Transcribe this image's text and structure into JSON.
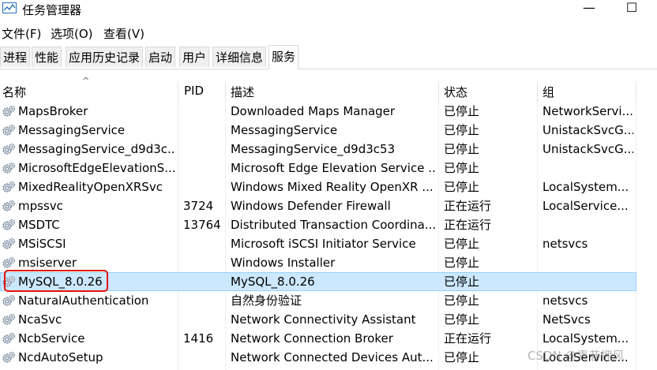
{
  "window": {
    "title": "任务管理器",
    "minimize": "—",
    "maximize": "☐"
  },
  "menu": [
    "文件(F)",
    "选项(O)",
    "查看(V)"
  ],
  "tabs": [
    "进程",
    "性能",
    "应用历史记录",
    "启动",
    "用户",
    "详细信息",
    "服务"
  ],
  "active_tab": "服务",
  "columns": {
    "name": "名称",
    "pid": "PID",
    "desc": "描述",
    "status": "状态",
    "group": "组"
  },
  "sort_indicator": "^",
  "services": [
    {
      "name": "MapsBroker",
      "pid": "",
      "desc": "Downloaded Maps Manager",
      "status": "已停止",
      "group": "NetworkServi..."
    },
    {
      "name": "MessagingService",
      "pid": "",
      "desc": "MessagingService",
      "status": "已停止",
      "group": "UnistackSvcG..."
    },
    {
      "name": "MessagingService_d9d3c...",
      "pid": "",
      "desc": "MessagingService_d9d3c53",
      "status": "已停止",
      "group": "UnistackSvcG..."
    },
    {
      "name": "MicrosoftEdgeElevationS...",
      "pid": "",
      "desc": "Microsoft Edge Elevation Service ...",
      "status": "已停止",
      "group": ""
    },
    {
      "name": "MixedRealityOpenXRSvc",
      "pid": "",
      "desc": "Windows Mixed Reality OpenXR ...",
      "status": "已停止",
      "group": "LocalSystem..."
    },
    {
      "name": "mpssvc",
      "pid": "3724",
      "desc": "Windows Defender Firewall",
      "status": "正在运行",
      "group": "LocalService..."
    },
    {
      "name": "MSDTC",
      "pid": "13764",
      "desc": "Distributed Transaction Coordina...",
      "status": "正在运行",
      "group": ""
    },
    {
      "name": "MSiSCSI",
      "pid": "",
      "desc": "Microsoft iSCSI Initiator Service",
      "status": "已停止",
      "group": "netsvcs"
    },
    {
      "name": "msiserver",
      "pid": "",
      "desc": "Windows Installer",
      "status": "已停止",
      "group": ""
    },
    {
      "name": "MySQL_8.0.26",
      "pid": "",
      "desc": "MySQL_8.0.26",
      "status": "已停止",
      "group": ""
    },
    {
      "name": "NaturalAuthentication",
      "pid": "",
      "desc": "自然身份验证",
      "status": "已停止",
      "group": "netsvcs"
    },
    {
      "name": "NcaSvc",
      "pid": "",
      "desc": "Network Connectivity Assistant",
      "status": "已停止",
      "group": "NetSvcs"
    },
    {
      "name": "NcbService",
      "pid": "1416",
      "desc": "Network Connection Broker",
      "status": "正在运行",
      "group": "LocalSystem..."
    },
    {
      "name": "NcdAutoSetup",
      "pid": "",
      "desc": "Network Connected Devices Aut...",
      "status": "已停止",
      "group": "LocalService..."
    }
  ],
  "selected_service": "MySQL_8.0.26",
  "watermark": "CSDN @青巷拥风"
}
